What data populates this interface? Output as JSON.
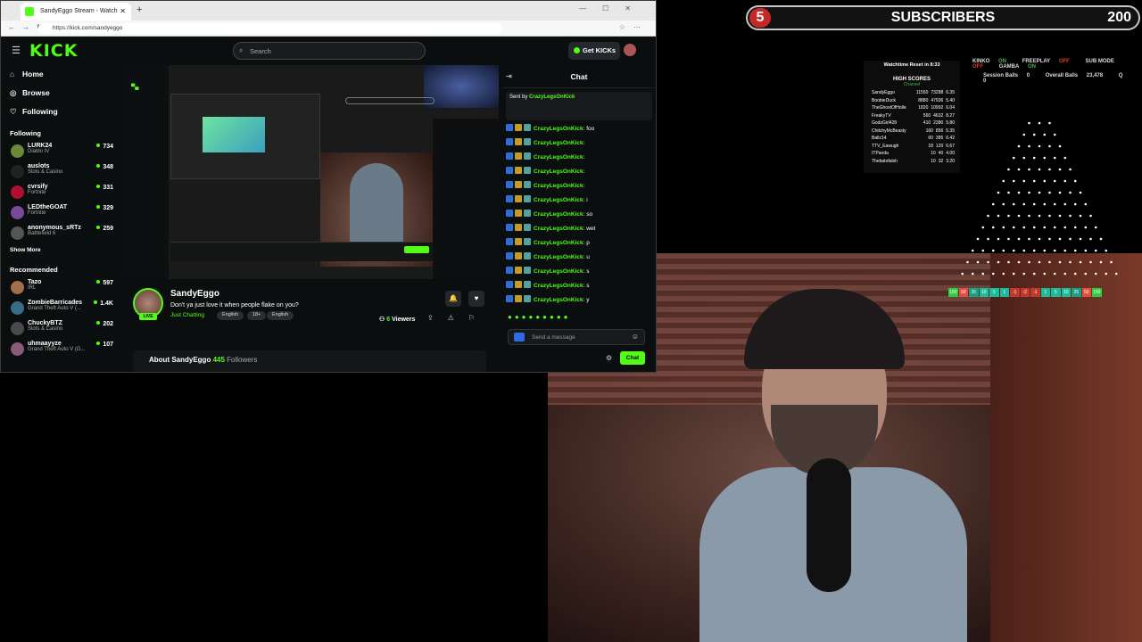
{
  "subscribers": {
    "count": "5",
    "label": "SUBSCRIBERS",
    "goal": "200"
  },
  "plinko": {
    "stats": {
      "kinko": "KINKO",
      "kinko_state": "ON",
      "freeplay": "FREEPLAY",
      "freeplay_state": "OFF",
      "submode": "SUB MODE",
      "submode_state": "OFF",
      "gamba": "GAMBA",
      "gamba_state": "ON",
      "session_balls_label": "Session Balls",
      "session_balls": "0",
      "overall_balls_label": "Overall Balls",
      "overall_balls": "23,478",
      "q_label": "Q",
      "q": "0"
    },
    "scores_top": "Watchtime Reset in 8:33",
    "scores_title": "HIGH SCORES",
    "scores_sub": "Channel",
    "scores": [
      {
        "name": "SandyEggo",
        "a": "11550",
        "b": "73288",
        "c": "6.35"
      },
      {
        "name": "BoobieDuck",
        "a": "8880",
        "b": "47936",
        "c": "5.40"
      },
      {
        "name": "TheGhostOfHolle",
        "a": "1820",
        "b": "10992",
        "c": "6.04"
      },
      {
        "name": "FreakyTV",
        "a": "560",
        "b": "4632",
        "c": "8.27"
      },
      {
        "name": "GodzGirl428",
        "a": "410",
        "b": "2380",
        "c": "5.80"
      },
      {
        "name": "ChitchyMcBeasty",
        "a": "160",
        "b": "856",
        "c": "5.35"
      },
      {
        "name": "Ballz14",
        "a": "60",
        "b": "385",
        "c": "6.42"
      },
      {
        "name": "TTV_Eawugh",
        "a": "18",
        "b": "120",
        "c": "6.67"
      },
      {
        "name": "ITPanda",
        "a": "10",
        "b": "40",
        "c": "4.00"
      },
      {
        "name": "Thebatofalsh",
        "a": "10",
        "b": "32",
        "c": "3.20"
      }
    ],
    "slots": [
      "150",
      "50",
      "25",
      "10",
      "5",
      "1",
      "-1",
      "-2",
      "-1",
      "1",
      "5",
      "10",
      "25",
      "50",
      "150"
    ],
    "slot_colors": [
      "#2ecc40",
      "#e74c3c",
      "#16a085",
      "#1abc9c",
      "#1abc9c",
      "#1abc9c",
      "#c0392b",
      "#c0392b",
      "#c0392b",
      "#1abc9c",
      "#1abc9c",
      "#1abc9c",
      "#16a085",
      "#e74c3c",
      "#2ecc40"
    ]
  },
  "browser": {
    "tab_title": "SandyEggo Stream - Watch",
    "url": "https://kick.com/sandyeggo"
  },
  "kick": {
    "logo": "KICK",
    "search_placeholder": "Search",
    "get_kicks": "Get KICKs",
    "nav": [
      {
        "icon": "⌂",
        "label": "Home"
      },
      {
        "icon": "◎",
        "label": "Browse"
      },
      {
        "icon": "♡",
        "label": "Following"
      }
    ],
    "following_header": "Following",
    "following": [
      {
        "name": "LURK24",
        "game": "Diablo IV",
        "viewers": "734",
        "color": "#6a8a3a"
      },
      {
        "name": "auslots",
        "game": "Slots & Casino",
        "viewers": "348",
        "color": "#222"
      },
      {
        "name": "cvrsify",
        "game": "Fortnite",
        "viewers": "331",
        "color": "#b01030"
      },
      {
        "name": "LEDtheGOAT",
        "game": "Fortnite",
        "viewers": "329",
        "color": "#7a4a9a"
      },
      {
        "name": "anonymous_sRTz",
        "game": "Battlefield 6",
        "viewers": "259",
        "color": "#555"
      }
    ],
    "show_more": "Show More",
    "recommended_header": "Recommended",
    "recommended": [
      {
        "name": "Tazo",
        "game": "IRL",
        "viewers": "597",
        "color": "#a0704a"
      },
      {
        "name": "ZombieBarricades",
        "game": "Grand Theft Auto V (...",
        "viewers": "1.4K",
        "color": "#3a6a8a"
      },
      {
        "name": "ChuckyBTZ",
        "game": "Slots & Casino",
        "viewers": "202",
        "color": "#4a4a4a"
      },
      {
        "name": "uhmaayyze",
        "game": "Grand Theft Auto V (G...",
        "viewers": "107",
        "color": "#8a5a7a"
      }
    ],
    "stream": {
      "name": "SandyEggo",
      "live": "LIVE",
      "title": "Don't ya just love it when people flake on you?",
      "category": "Just Chatting",
      "tags": [
        "English",
        "18+",
        "English"
      ],
      "viewers_count": "6",
      "viewers_label": "Viewers",
      "about_prefix": "About SandyEggo",
      "followers_count": "445",
      "followers_label": "Followers"
    },
    "chat": {
      "title": "Chat",
      "pinned_prefix": "Sent by",
      "pinned_user": "CrazyLegsOnKick",
      "messages": [
        {
          "user": "CrazyLegsOnKick",
          "text": ": foo"
        },
        {
          "user": "CrazyLegsOnKick",
          "text": ":"
        },
        {
          "user": "CrazyLegsOnKick",
          "text": ":"
        },
        {
          "user": "CrazyLegsOnKick",
          "text": ":"
        },
        {
          "user": "CrazyLegsOnKick",
          "text": ":"
        },
        {
          "user": "CrazyLegsOnKick",
          "text": ": i"
        },
        {
          "user": "CrazyLegsOnKick",
          "text": ": so"
        },
        {
          "user": "CrazyLegsOnKick",
          "text": ": wet"
        },
        {
          "user": "CrazyLegsOnKick",
          "text": ": p"
        },
        {
          "user": "CrazyLegsOnKick",
          "text": ": u"
        },
        {
          "user": "CrazyLegsOnKick",
          "text": ": s"
        },
        {
          "user": "CrazyLegsOnKick",
          "text": ": s"
        },
        {
          "user": "CrazyLegsOnKick",
          "text": ": y"
        }
      ],
      "input_placeholder": "Send a message",
      "send_label": "Chat"
    }
  }
}
